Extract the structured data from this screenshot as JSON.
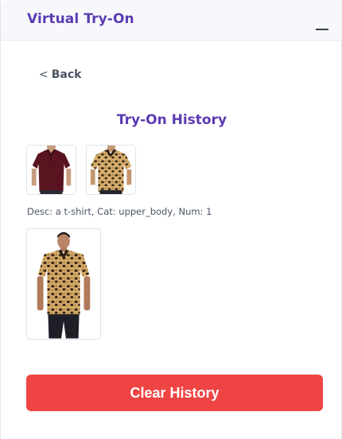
{
  "header": {
    "title": "Virtual Try-On",
    "minimize_icon": "minimize-icon"
  },
  "nav": {
    "back_arrow": "<",
    "back_label": "Back"
  },
  "history": {
    "title": "Try-On History",
    "entries": [
      {
        "inputs": [
          {
            "icon": "maroon-polo-shirt-thumbnail"
          },
          {
            "icon": "leopard-print-shirt-thumbnail"
          }
        ],
        "description": "Desc: a t-shirt, Cat: upper_body, Num: 1",
        "result": {
          "icon": "model-wearing-leopard-shirt-image"
        }
      }
    ]
  },
  "actions": {
    "clear_label": "Clear History"
  },
  "colors": {
    "accent": "#5b3bb2",
    "danger": "#ef4444",
    "header_bg": "#f7f8fb"
  }
}
